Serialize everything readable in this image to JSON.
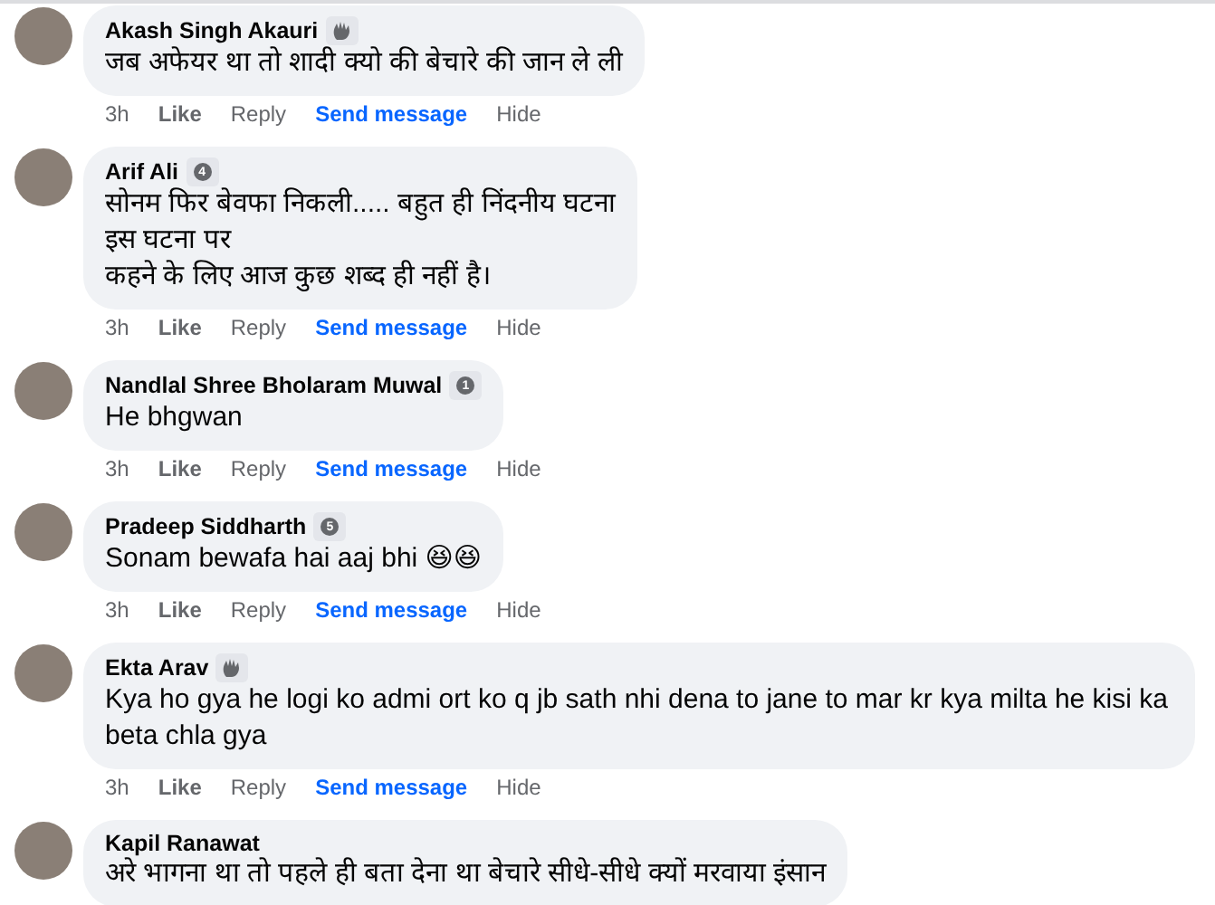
{
  "comments": [
    {
      "author": "Akash Singh Akauri",
      "badge": {
        "kind": "fan"
      },
      "text": [
        "जब अफेयर था तो शादी क्यो की बेचारे की जान ले ली"
      ],
      "actions": {
        "time": "3h",
        "like": "Like",
        "reply": "Reply",
        "message": "Send message",
        "hide": "Hide"
      }
    },
    {
      "author": "Arif Ali",
      "badge": {
        "kind": "number",
        "text": "4"
      },
      "text": [
        "सोनम फिर बेवफा निकली..... बहुत ही निंदनीय घटना",
        "इस घटना पर",
        "कहने के लिए आज कुछ शब्द ही नहीं है।"
      ],
      "actions": {
        "time": "3h",
        "like": "Like",
        "reply": "Reply",
        "message": "Send message",
        "hide": "Hide"
      }
    },
    {
      "author": "Nandlal Shree Bholaram Muwal",
      "badge": {
        "kind": "number",
        "text": "1"
      },
      "text": [
        "He bhgwan"
      ],
      "actions": {
        "time": "3h",
        "like": "Like",
        "reply": "Reply",
        "message": "Send message",
        "hide": "Hide"
      }
    },
    {
      "author": "Pradeep Siddharth",
      "badge": {
        "kind": "number",
        "text": "5"
      },
      "text": [
        "Sonam bewafa hai aaj bhi 😆😆"
      ],
      "actions": {
        "time": "3h",
        "like": "Like",
        "reply": "Reply",
        "message": "Send message",
        "hide": "Hide"
      }
    },
    {
      "author": "Ekta Arav",
      "badge": {
        "kind": "fan"
      },
      "text": [
        "Kya ho gya he logi ko admi ort ko q jb sath nhi dena to jane to mar kr kya milta he kisi ka beta chla gya"
      ],
      "actions": {
        "time": "3h",
        "like": "Like",
        "reply": "Reply",
        "message": "Send message",
        "hide": "Hide"
      }
    },
    {
      "author": "Kapil Ranawat",
      "text": [
        "अरे भागना था तो पहले ही बता देना था बेचारे सीधे-सीधे क्यों मरवाया इंसान"
      ]
    }
  ]
}
